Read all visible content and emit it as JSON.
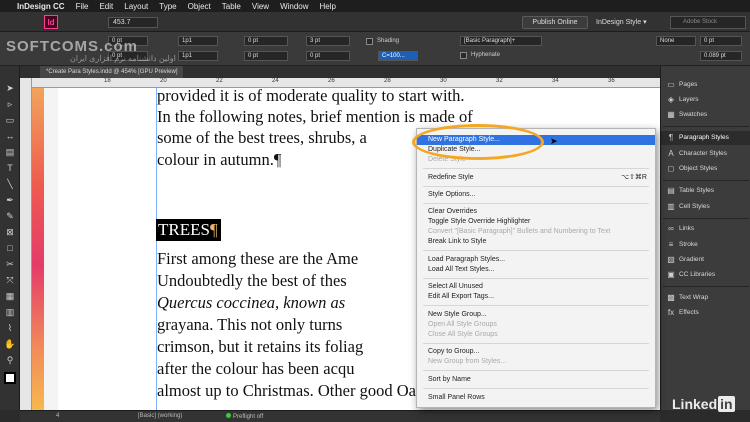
{
  "menubar": {
    "app": "InDesign CC",
    "items": [
      "File",
      "Edit",
      "Layout",
      "Type",
      "Object",
      "Table",
      "View",
      "Window",
      "Help"
    ]
  },
  "appbar": {
    "logo": "Id",
    "zoom": "453.7",
    "publish": "Publish Online",
    "workspace": "InDesign Style ▾",
    "search_placeholder": "Adobe Stock"
  },
  "controlbar": {
    "f1": "0 pt",
    "f2": "0 pt",
    "f3": "1p1",
    "f4": "1p1",
    "f5": "0 pt",
    "f6": "0 pt",
    "f7": "0 pt",
    "f8": "3 pt",
    "shading_label": "Shading",
    "hyphenate_label": "Hyphenate",
    "color_label": "C=100...",
    "para_style": "[Basic Paragraph]+",
    "none_label": "None",
    "r1": "0 pt",
    "r2": "0.089 pt"
  },
  "doc_tab": "*Create Para Styles.indd @ 454% [GPU Preview]",
  "ruler_marks": [
    "18",
    "20",
    "22",
    "24",
    "26",
    "28",
    "30",
    "32",
    "34",
    "36"
  ],
  "canvas": {
    "lines": [
      "provided it is of moderate quality to start with.",
      "In the following notes, brief mention is made of",
      "some of the best trees, shrubs, a",
      "colour in autumn.¶",
      "First among these are the Ame",
      "Undoubtedly the best of thes",
      "Quercus coccinea, known as",
      "grayana. This not only turns",
      "crimson, but it retains its foliag",
      "after the colour has been acqu",
      "almost up to Christmas. Other good Oaks, no"
    ],
    "heading": "TREES",
    "heading_mark": "¶"
  },
  "statusbar": {
    "page": "4",
    "style": "[Basic] (working)",
    "preflight": "Preflight off"
  },
  "panels": [
    {
      "label": "Pages",
      "icon": "pages-icon"
    },
    {
      "label": "Layers",
      "icon": "layers-icon"
    },
    {
      "label": "Swatches",
      "icon": "swatches-icon"
    },
    {
      "label": "Paragraph Styles",
      "icon": "paragraph-styles-icon"
    },
    {
      "label": "Character Styles",
      "icon": "character-styles-icon"
    },
    {
      "label": "Object Styles",
      "icon": "object-styles-icon"
    },
    {
      "label": "Table Styles",
      "icon": "table-styles-icon"
    },
    {
      "label": "Cell Styles",
      "icon": "cell-styles-icon"
    },
    {
      "label": "Links",
      "icon": "links-icon"
    },
    {
      "label": "Stroke",
      "icon": "stroke-icon"
    },
    {
      "label": "Gradient",
      "icon": "gradient-icon"
    },
    {
      "label": "CC Libraries",
      "icon": "cc-libraries-icon"
    },
    {
      "label": "Text Wrap",
      "icon": "text-wrap-icon"
    },
    {
      "label": "Effects",
      "icon": "effects-icon"
    }
  ],
  "menu": {
    "items": [
      {
        "label": "New Paragraph Style...",
        "state": "selected"
      },
      {
        "label": "Duplicate Style...",
        "state": "normal"
      },
      {
        "label": "Delete Style",
        "state": "disabled"
      },
      {
        "label": "Redefine Style",
        "state": "normal",
        "shortcut": "⌥⇧⌘R"
      },
      {
        "label": "Style Options...",
        "state": "normal"
      },
      {
        "label": "Clear Overrides",
        "state": "normal"
      },
      {
        "label": "Toggle Style Override Highlighter",
        "state": "normal"
      },
      {
        "label": "Convert \"[Basic Paragraph]\" Bullets and Numbering to Text",
        "state": "disabled"
      },
      {
        "label": "Break Link to Style",
        "state": "normal"
      },
      {
        "label": "Load Paragraph Styles...",
        "state": "normal"
      },
      {
        "label": "Load All Text Styles...",
        "state": "normal"
      },
      {
        "label": "Select All Unused",
        "state": "normal"
      },
      {
        "label": "Edit All Export Tags...",
        "state": "normal"
      },
      {
        "label": "New Style Group...",
        "state": "normal"
      },
      {
        "label": "Open All Style Groups",
        "state": "disabled"
      },
      {
        "label": "Close All Style Groups",
        "state": "disabled"
      },
      {
        "label": "Copy to Group...",
        "state": "normal"
      },
      {
        "label": "New Group from Styles...",
        "state": "disabled"
      },
      {
        "label": "Sort by Name",
        "state": "normal"
      },
      {
        "label": "Small Panel Rows",
        "state": "normal"
      }
    ]
  },
  "watermark": "SOFTCOMS.com",
  "watermark_sub": "اولین دانشنامه نرم افزاری ایران",
  "brand": "Linked",
  "brand_in": "in"
}
